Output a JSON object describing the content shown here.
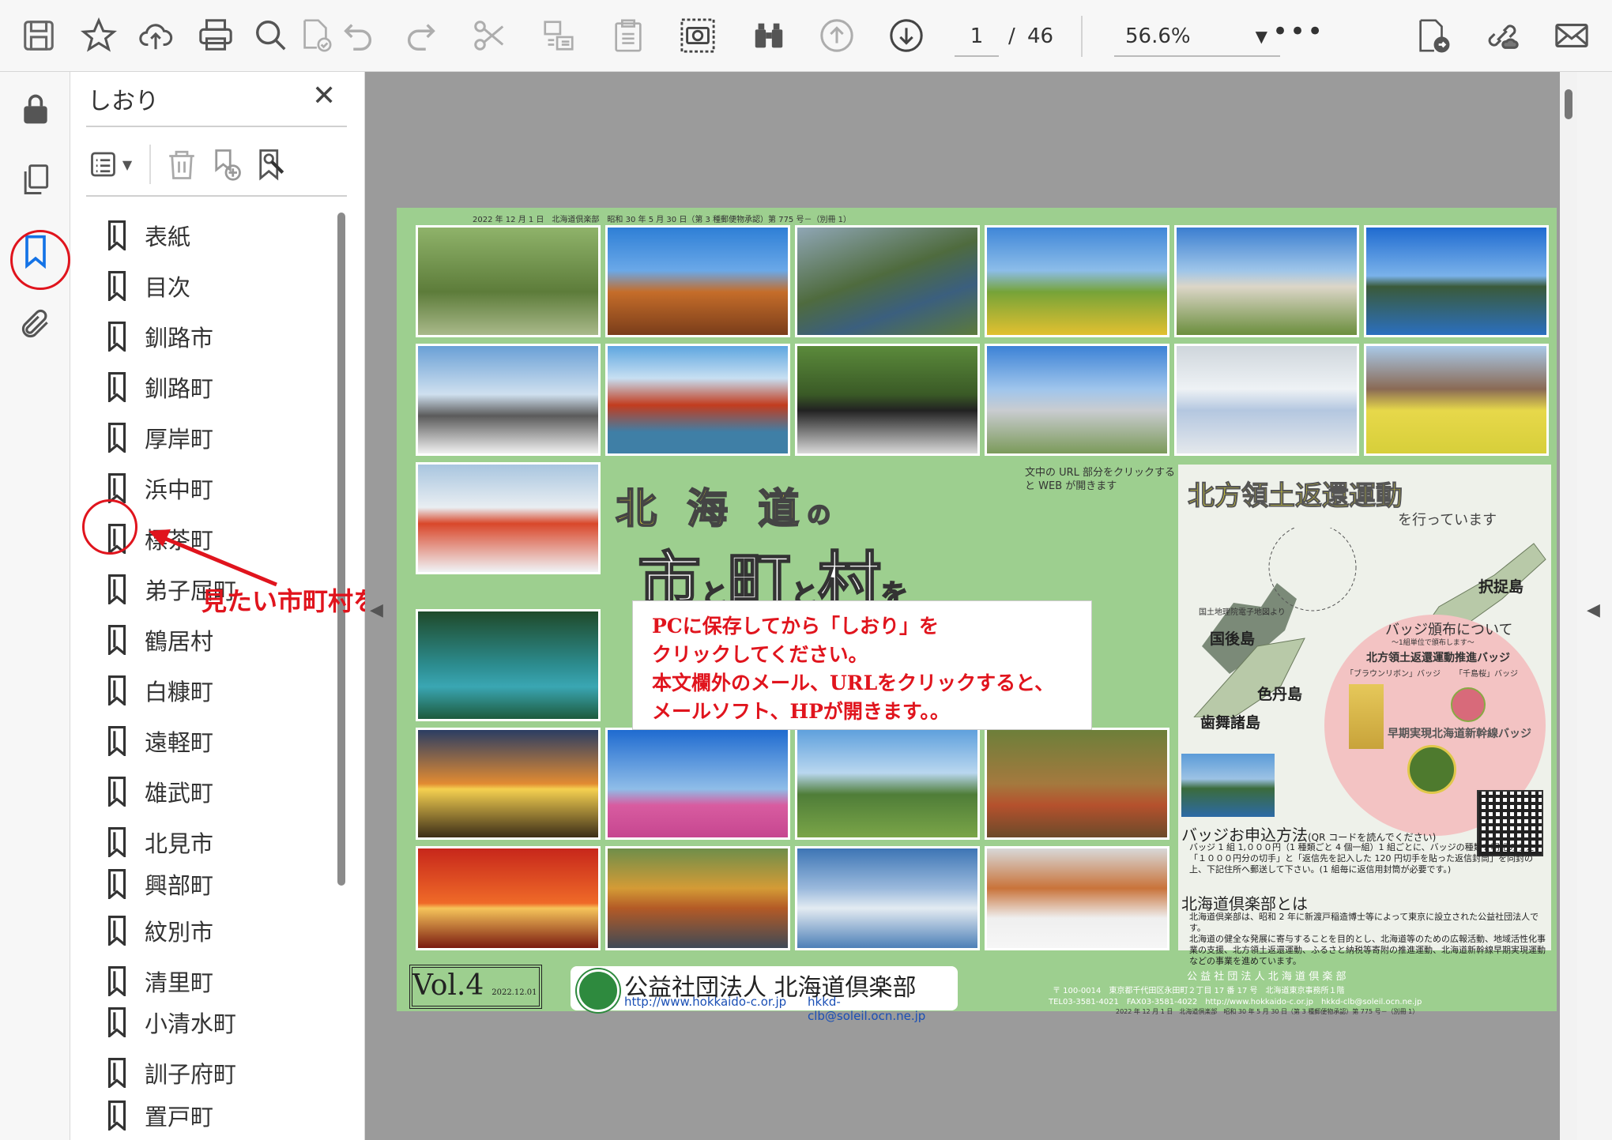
{
  "toolbar": {
    "icons": [
      "save-icon",
      "star-icon",
      "upload-cloud-icon",
      "print-icon",
      "zoom-search-icon",
      "spellcheck-icon",
      "undo-icon",
      "redo-icon",
      "scissors-icon",
      "copy-text-icon",
      "clipboard-icon",
      "snapshot-camera-icon",
      "binoculars-icon",
      "page-up-icon",
      "page-down-icon"
    ],
    "page_current": "1",
    "page_separator": "/",
    "page_total": "46",
    "zoom": "56.6%",
    "more": "•••",
    "right_icons": [
      "export-pdf-icon",
      "link-cloud-icon",
      "mail-icon"
    ]
  },
  "rail": {
    "icons": [
      "lock-icon",
      "pages-icon",
      "bookmark-icon",
      "paperclip-icon"
    ],
    "active": "bookmark-icon"
  },
  "bookmarks_panel": {
    "title": "しおり",
    "tools": [
      "options-list-icon",
      "delete-icon",
      "add-bookmark-icon",
      "find-bookmark-icon"
    ],
    "items": [
      {
        "label": "表紙"
      },
      {
        "label": "目次"
      },
      {
        "label": "釧路市"
      },
      {
        "label": "釧路町"
      },
      {
        "label": "厚岸町"
      },
      {
        "label": "浜中町"
      },
      {
        "label": "標茶町"
      },
      {
        "label": "弟子屈町"
      },
      {
        "label": "鶴居村"
      },
      {
        "label": "白糠町"
      },
      {
        "label": "遠軽町"
      },
      {
        "label": "雄武町"
      },
      {
        "label": "北見市"
      },
      {
        "label": "興部町"
      },
      {
        "label": "紋別市"
      },
      {
        "label": "清里町"
      },
      {
        "label": "小清水町"
      },
      {
        "label": "訓子府町"
      },
      {
        "label": "置戸町"
      }
    ]
  },
  "annotation": {
    "text": "見たい市町村をクリック",
    "color": "#e0141d"
  },
  "document": {
    "header_line": "2022 年 12 月 1 日　北海道倶楽部　昭和 30 年 5 月 30 日（第 3 種郵便物承認）第 775 号－（別冊 1）",
    "title_hokkaido": "北 海 道",
    "title_no": "の",
    "title_shi": "市",
    "title_to1": "と",
    "title_machi": "町",
    "title_to2": "と",
    "title_mura": "村",
    "title_wo": "を",
    "url_note": "文中の URL 部分をクリックすると WEB が開きます",
    "message": [
      "PCに保存してから「しおり」を",
      "クリックしてください。",
      "本文欄外のメール、URLをクリックすると、",
      "メールソフト、HPが開きます。。"
    ],
    "northern": {
      "title": "北方領土返還運動",
      "subtitle": "を行っています",
      "map_source": "国土地理院電子地図より",
      "islands": {
        "etorofu": "択捉島",
        "kunashiri": "国後島",
        "shikotan": "色丹島",
        "habomai": "歯舞諸島"
      },
      "badge_title": "バッジ頒布について",
      "badge_sub": "～1組単位で頒布します～",
      "badge_line1": "北方領土返還運動推進バッジ",
      "badge_opt1": "「ブラウンリボン」バッジ",
      "badge_opt2": "「千島桜」バッジ",
      "badge_line2": "早期実現北海道新幹線バッジ",
      "apply_heading": "バッジお申込方法",
      "apply_qr": "(QR コードを読んでください)",
      "apply_text": "バッジ 1 組 1,０００円（1 種類ごと 4 個一組）1 組ごとに、バッジの種類を明記のうえ、「１０００円分の切手」と「返信先を記入した 120 円切手を貼った返信封筒」を同封の上、下記住所へ郵送して下さい。(1 組毎に返信用封筒が必要です。)",
      "club_heading": "北海道倶楽部とは",
      "club_text1": "北海道倶楽部は、昭和 2 年に新渡戸稲造博士等によって東京に設立された公益社団法人です。",
      "club_text2": "北海道の健全な発展に寄与することを目的とし、北海道等のための広報活動、地域活性化事業の支援、北方領土返還運動、ふるさと納税等寄附の推進運動、北海道新幹線早期実現運動などの事業を進めています。"
    },
    "vol": "Vol.4",
    "vol_date": "2022.12.01",
    "club_name": "公益社団法人 北海道倶楽部",
    "club_url": "http://www.hokkaido-c.or.jp",
    "club_mail": "hkkd-clb@soleil.ocn.ne.jp",
    "footer_org": "公 益 社 団 法 人 北 海 道 倶 楽 部",
    "footer_addr": "〒 100-0014　東京都千代田区永田町２丁目 17 番 17 号　北海道東京事務所１階",
    "footer_tel": "TEL03-3581-4021　FAX03-3581-4022　http://www.hokkaido-c.or.jp　hkkd-clb@soleil.ocn.ne.jp",
    "footer_line": "2022 年 12 月 1 日　北海道倶楽部　昭和 30 年 5 月 30 日（第 3 種郵便物承認）第 775 号－（別冊 1）"
  }
}
